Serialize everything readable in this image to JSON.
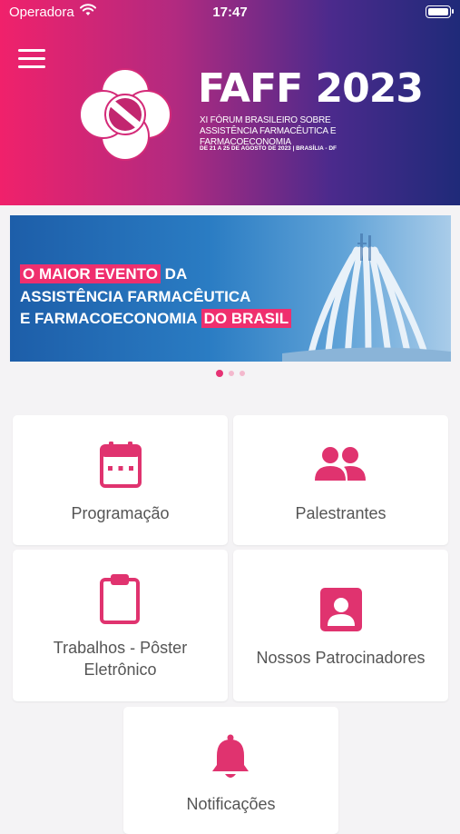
{
  "status_bar": {
    "carrier": "Operadora",
    "time": "17:47"
  },
  "header": {
    "title": "FAFF 2023",
    "subtitle": "XI FÓRUM BRASILEIRO SOBRE ASSISTÊNCIA FARMACÊUTICA E FARMACOECONOMIA",
    "dates": "DE 21 A 25 DE AGOSTO DE 2023 | BRASÍLIA - DF"
  },
  "banner": {
    "line1_highlight": "O MAIOR EVENTO",
    "line1_rest": " DA",
    "line2": "ASSISTÊNCIA FARMACÊUTICA",
    "line3_rest": "E FARMACOECONOMIA ",
    "line3_highlight": "DO BRASIL"
  },
  "carousel": {
    "page_count": 3,
    "active_index": 0
  },
  "menu": {
    "programacao": "Programação",
    "palestrantes": "Palestrantes",
    "trabalhos_line1": "Trabalhos - Pôster",
    "trabalhos_line2": "Eletrônico",
    "patrocinadores": "Nossos Patrocinadores",
    "notificacoes": "Notificações"
  },
  "colors": {
    "accent": "#e0336f",
    "header_gradient_start": "#f0216b",
    "header_gradient_end": "#1f2a79"
  },
  "icons": {
    "programacao": "calendar-icon",
    "palestrantes": "people-icon",
    "trabalhos": "clipboard-icon",
    "patrocinadores": "badge-icon",
    "notificacoes": "bell-icon"
  }
}
